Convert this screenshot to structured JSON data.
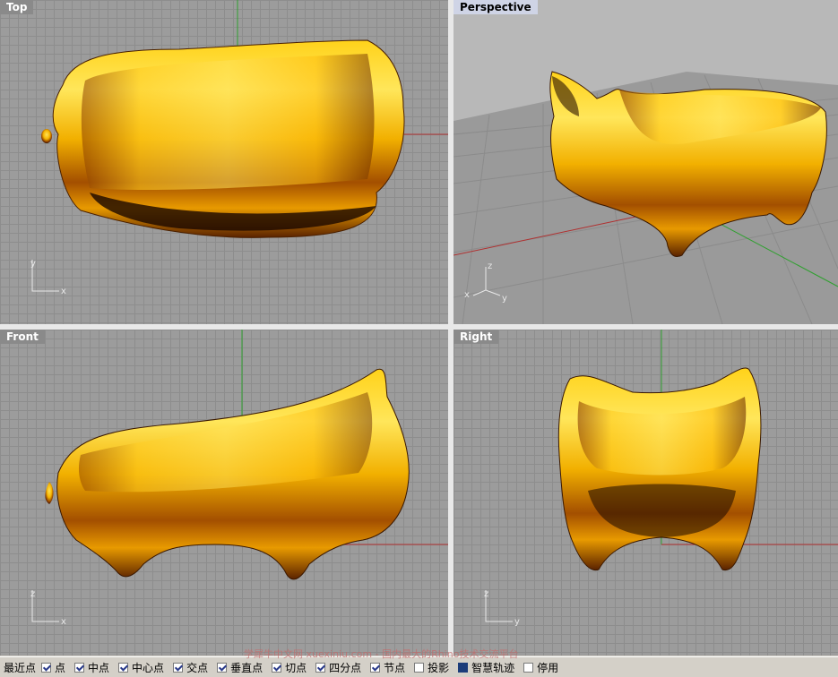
{
  "viewports": {
    "top": {
      "title": "Top",
      "axis_labels": [
        "y",
        "x"
      ]
    },
    "perspective": {
      "title": "Perspective",
      "axis_labels": [
        "z",
        "x",
        "y"
      ]
    },
    "front": {
      "title": "Front",
      "axis_labels": [
        "z",
        "x"
      ]
    },
    "right": {
      "title": "Right",
      "axis_labels": [
        "z",
        "y"
      ]
    }
  },
  "statusbar": {
    "first_label": "最近点",
    "snaps": [
      {
        "label": "点",
        "checked": true
      },
      {
        "label": "中点",
        "checked": true
      },
      {
        "label": "中心点",
        "checked": true
      },
      {
        "label": "交点",
        "checked": true
      },
      {
        "label": "垂直点",
        "checked": true
      },
      {
        "label": "切点",
        "checked": true
      },
      {
        "label": "四分点",
        "checked": true
      },
      {
        "label": "节点",
        "checked": true
      },
      {
        "label": "投影",
        "checked": false
      },
      {
        "label": "智慧轨迹",
        "checked": "filled"
      },
      {
        "label": "停用",
        "checked": false
      }
    ]
  },
  "watermark": "学犀牛中文网 xuexiniu.com - 国内最大的Rhino技术交流平台",
  "colors": {
    "gold_light": "#ffe04a",
    "gold_mid": "#f0a800",
    "gold_dark": "#7a3a00",
    "x_axis": "#b03030",
    "y_axis": "#30a030"
  }
}
